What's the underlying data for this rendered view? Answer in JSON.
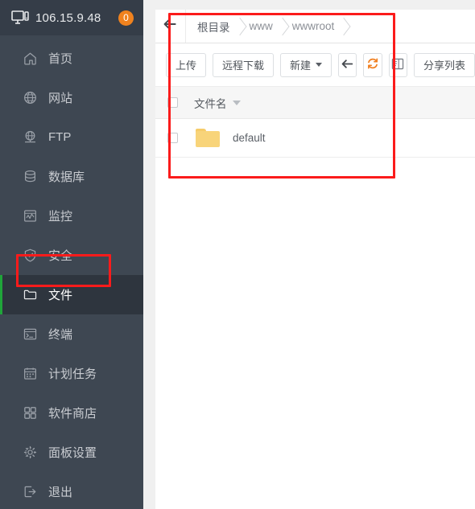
{
  "sidebar": {
    "header": {
      "icon": "monitor-icon",
      "ip": "106.15.9.48",
      "badge_count": "0",
      "badge_color": "#f0821e"
    },
    "items": [
      {
        "icon": "home-icon",
        "label": "首页",
        "active": false
      },
      {
        "icon": "globe-icon",
        "label": "网站",
        "active": false
      },
      {
        "icon": "ftp-icon",
        "label": "FTP",
        "active": false
      },
      {
        "icon": "database-icon",
        "label": "数据库",
        "active": false
      },
      {
        "icon": "monitor-chart-icon",
        "label": "监控",
        "active": false
      },
      {
        "icon": "shield-check-icon",
        "label": "安全",
        "active": false
      },
      {
        "icon": "folder-icon",
        "label": "文件",
        "active": true
      },
      {
        "icon": "terminal-icon",
        "label": "终端",
        "active": false
      },
      {
        "icon": "calendar-icon",
        "label": "计划任务",
        "active": false
      },
      {
        "icon": "grid-icon",
        "label": "软件商店",
        "active": false
      },
      {
        "icon": "gear-icon",
        "label": "面板设置",
        "active": false
      },
      {
        "icon": "logout-icon",
        "label": "退出",
        "active": false
      }
    ],
    "active_accent_color": "#20a53a",
    "background_color": "#3e4752"
  },
  "content": {
    "breadcrumb": {
      "back_icon": "arrow-left-icon",
      "crumbs": [
        "根目录",
        "www",
        "wwwroot"
      ]
    },
    "toolbar": {
      "upload_label": "上传",
      "remote_download_label": "远程下载",
      "new_label": "新建",
      "back_icon": "arrow-left-icon",
      "refresh_icon": "refresh-icon",
      "terminal_icon": "terminal-window-icon",
      "share_list_label": "分享列表"
    },
    "table": {
      "columns": [
        "文件名"
      ],
      "rows": [
        {
          "name": "default",
          "icon": "folder-icon",
          "selected": false
        }
      ]
    }
  },
  "annotations": {
    "highlight_color": "#fb1b1b",
    "boxes": [
      "sidebar-file-item",
      "file-manager-panel"
    ]
  }
}
